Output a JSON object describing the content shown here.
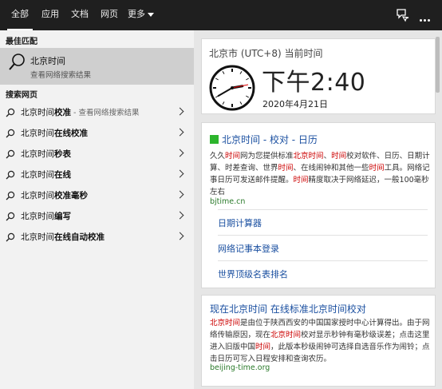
{
  "tabs": [
    {
      "label": "全部"
    },
    {
      "label": "应用"
    },
    {
      "label": "文档"
    },
    {
      "label": "网页"
    },
    {
      "label": "更多"
    }
  ],
  "left": {
    "best_label": "最佳匹配",
    "best_title": "北京时间",
    "best_sub": "查看网络搜索结果",
    "web_label": "搜索网页",
    "suggestions": [
      {
        "prefix": "北京时间",
        "bold": "校准",
        "hint": " - 查看网络搜索结果"
      },
      {
        "prefix": "北京时间",
        "bold": "在线校准",
        "hint": ""
      },
      {
        "prefix": "北京时间",
        "bold": "秒表",
        "hint": ""
      },
      {
        "prefix": "北京时间",
        "bold": "在线",
        "hint": ""
      },
      {
        "prefix": "北京时间",
        "bold": "校准毫秒",
        "hint": ""
      },
      {
        "prefix": "北京时间",
        "bold": "编写",
        "hint": ""
      },
      {
        "prefix": "北京时间",
        "bold": "在线自动校准",
        "hint": ""
      }
    ]
  },
  "time_card": {
    "title": "北京市 (UTC+8) 当前时间",
    "time": "下午2:40",
    "date": "2020年4月21日"
  },
  "result1": {
    "title": "北京时间 - 校对 - 日历",
    "snippet_parts": [
      {
        "t": "久久",
        "h": false
      },
      {
        "t": "时间",
        "h": true
      },
      {
        "t": "网为您提供标准",
        "h": false
      },
      {
        "t": "北京时间",
        "h": true
      },
      {
        "t": "、",
        "h": false
      },
      {
        "t": "时间",
        "h": true
      },
      {
        "t": "校对软件、日历、日期计算、",
        "h": false
      },
      {
        "t": "时差查询、世界",
        "h": false
      },
      {
        "t": "时间",
        "h": true
      },
      {
        "t": "、在线闹钟和其他一些",
        "h": false
      },
      {
        "t": "时间",
        "h": true
      },
      {
        "t": "工具。网络记事日历可发送邮件提醒。",
        "h": false
      },
      {
        "t": "时间",
        "h": true
      },
      {
        "t": "精度取决于网络延迟，一般100毫秒左右",
        "h": false
      }
    ],
    "url": "bjtime.cn",
    "sublinks": [
      "日期计算器",
      "网络记事本登录",
      "世界顶级名表排名"
    ]
  },
  "result2": {
    "title": "现在北京时间 在线标准北京时间校对",
    "snippet_parts": [
      {
        "t": "北京时间",
        "h": true
      },
      {
        "t": "是由位于陕西西安的中国国家授时中心计算得出。由于网络传输原因，现在",
        "h": false
      },
      {
        "t": "北京时间",
        "h": true
      },
      {
        "t": "校对显示秒钟有毫秒级误差；点击这里进入旧版中国",
        "h": false
      },
      {
        "t": "时间",
        "h": true
      },
      {
        "t": "，此版本秒级闹钟可选择自选音乐作为闹铃；点击日历可写入日程安排和查询农历。",
        "h": false
      }
    ],
    "url": "beijing-time.org"
  },
  "clock": {
    "hour": 2,
    "minute": 40
  },
  "colors": {
    "topbar": "#1f1f1f",
    "link": "#1a4fa0",
    "highlight": "#cc0000",
    "url": "#2a7a2a"
  }
}
